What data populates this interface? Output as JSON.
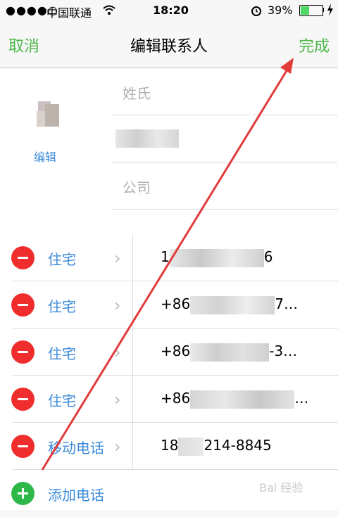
{
  "status_bar": {
    "signal": "●●●●○",
    "carrier": "中国联通",
    "wifi_icon": "wifi-icon",
    "time": "18:20",
    "alarm_icon": "alarm-icon",
    "battery": "39%",
    "battery_level": 0.39,
    "charging_icon": "charging-bolt-icon"
  },
  "navbar": {
    "cancel_label": "取消",
    "title": "编辑联系人",
    "done_label": "完成",
    "accent_color": "#4cb84a"
  },
  "contact": {
    "edit_photo_label": "编辑",
    "last_name_placeholder": "姓氏",
    "first_name_value": "",
    "company_placeholder": "公司"
  },
  "phones": [
    {
      "label": "住宅",
      "number": "1",
      "number_suffix": "6"
    },
    {
      "label": "住宅",
      "number": "+86",
      "number_suffix": "7…"
    },
    {
      "label": "住宅",
      "number": "+86",
      "number_suffix": "-3…"
    },
    {
      "label": "住宅",
      "number": "+86",
      "number_suffix": "…"
    },
    {
      "label": "移动电话",
      "number": "18",
      "number_suffix": "214-8845"
    }
  ],
  "add_phone_label": "添加电话",
  "watermark": "Bai 经验",
  "colors": {
    "link_blue": "#3b8ad9",
    "delete_red": "#f02d2d",
    "add_green": "#2fb84a",
    "annotation_arrow": "#e23b3b"
  }
}
